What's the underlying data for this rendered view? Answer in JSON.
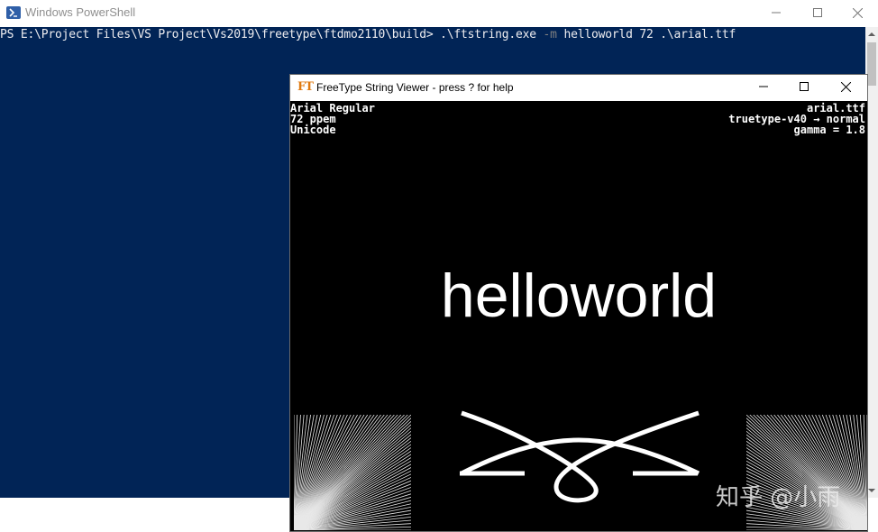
{
  "powershell": {
    "title": "Windows PowerShell",
    "prompt": "PS E:\\Project Files\\VS Project\\Vs2019\\freetype\\ftdmo2110\\build> ",
    "command": ".\\ftstring.exe",
    "flag": "-m",
    "args": "helloworld 72 .\\arial.ttf",
    "colors": {
      "background": "#012456",
      "text": "#eeedf0"
    },
    "icons": [
      "powershell-icon",
      "minimize-icon",
      "maximize-icon",
      "close-icon",
      "scroll-up-icon",
      "scroll-down-icon"
    ]
  },
  "viewer": {
    "title": "FreeType String Viewer - press ? for help",
    "info_left": [
      "Arial Regular",
      "72 ppem",
      "Unicode"
    ],
    "info_right": [
      "arial.ttf",
      "truetype-v40 → normal",
      "gamma = 1.8"
    ],
    "sample_text": "helloworld",
    "icons": [
      "freetype-logo-icon",
      "minimize-icon",
      "maximize-icon",
      "close-icon"
    ]
  },
  "watermark": {
    "text": "知乎 @小雨"
  }
}
